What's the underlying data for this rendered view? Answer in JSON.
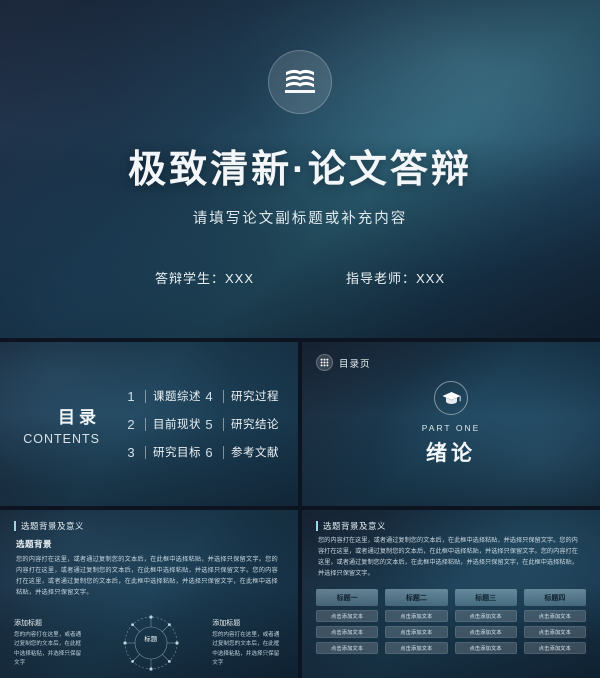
{
  "cover": {
    "logo_icon": "books-icon",
    "title": "极致清新·论文答辩",
    "subtitle": "请填写论文副标题或补充内容",
    "meta": [
      {
        "label": "答辩学生：XXX"
      },
      {
        "label": "指导老师：XXX"
      }
    ]
  },
  "contents": {
    "title_cn": "目录",
    "title_en": "CONTENTS",
    "items": [
      {
        "num": "1",
        "text": "课题综述"
      },
      {
        "num": "4",
        "text": "研究过程"
      },
      {
        "num": "2",
        "text": "目前现状"
      },
      {
        "num": "5",
        "text": "研究结论"
      },
      {
        "num": "3",
        "text": "研究目标"
      },
      {
        "num": "6",
        "text": "参考文献"
      }
    ]
  },
  "part": {
    "tag_icon": "grid-dots-icon",
    "tag_text": "目录页",
    "cap_icon": "graduation-cap-icon",
    "part_label": "PART ONE",
    "part_title": "绪论"
  },
  "background_slide": {
    "header": "选题背景及意义",
    "heading": "选题背景",
    "paragraph": "您的内容打在这里，或者通过复制您的文本后，在此框中选择粘贴，并选择只保留文字。您的内容打在这里，或者通过复制您的文本后，在此框中选择粘贴，并选择只保留文字。您的内容打在这里，或者通过复制您的文本后，在此框中选择粘贴，并选择只保留文字，在此框中选择粘贴，并选择只保留文字。",
    "left_card": {
      "title": "添加标题",
      "text": "您的内容打在这里，或者通过复制您的文本后，在此框中选择粘贴，并选择只保留文字"
    },
    "right_card": {
      "title": "添加标题",
      "text": "您的内容打在这里，或者通过复制您的文本后，在此框中选择粘贴，并选择只保留文字"
    },
    "ring_label": "标题"
  },
  "table_slide": {
    "header": "选题背景及意义",
    "paragraph": "您的内容打在这里，或者通过复制您的文本后，在此框中选择粘贴，并选择只保留文字。您的内容打在这里，或者通过复制您的文本后，在此框中选择粘贴，并选择只保留文字。您的内容打在这里，或者通过复制您的文本后，在此框中选择粘贴，并选择只保留文字，在此框中选择粘贴，并选择只保留文字。",
    "columns": [
      {
        "head": "标题一",
        "cells": [
          "点击添加文本",
          "点击添加文本",
          "点击添加文本"
        ]
      },
      {
        "head": "标题二",
        "cells": [
          "点击添加文本",
          "点击添加文本",
          "点击添加文本"
        ]
      },
      {
        "head": "标题三",
        "cells": [
          "点击添加文本",
          "点击添加文本",
          "点击添加文本"
        ]
      },
      {
        "head": "标题四",
        "cells": [
          "点击添加文本",
          "点击添加文本",
          "点击添加文本"
        ]
      }
    ]
  },
  "colors": {
    "accent": "#9fd3e6",
    "deep_blue": "#16283c",
    "teal": "#2a5f72"
  }
}
